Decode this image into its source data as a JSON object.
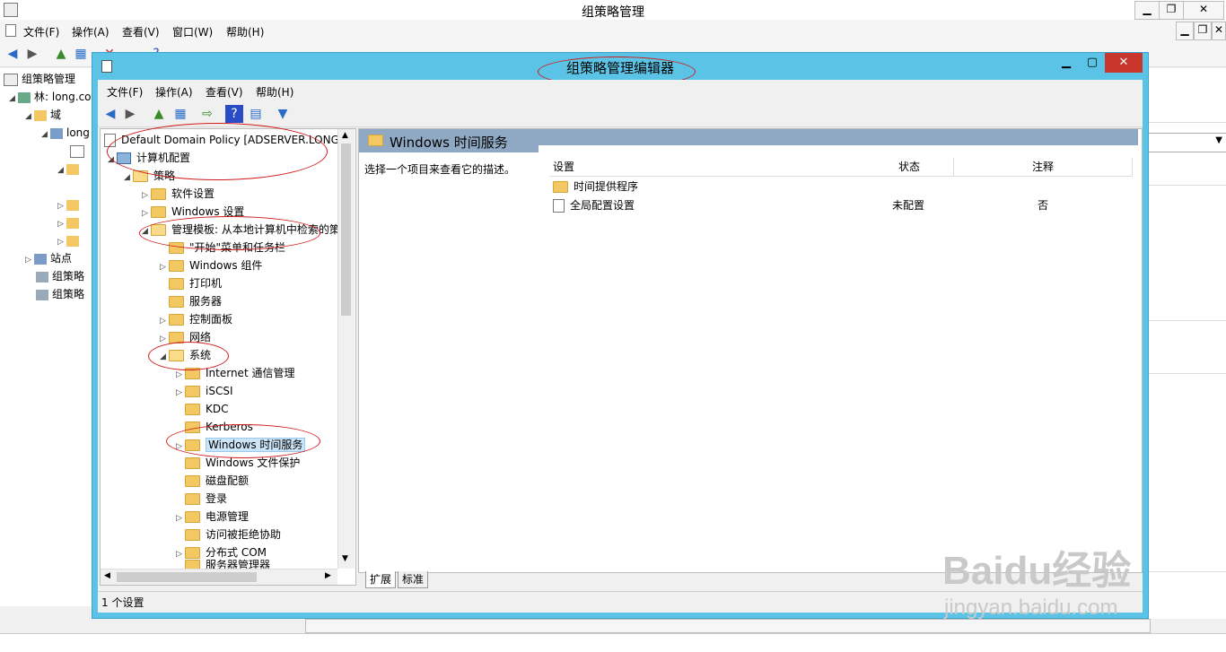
{
  "outer": {
    "title": "组策略管理",
    "menu": [
      "文件(F)",
      "操作(A)",
      "查看(V)",
      "窗口(W)",
      "帮助(H)"
    ],
    "tree": [
      {
        "label": "组策略管理"
      },
      {
        "label": "林: long.co"
      },
      {
        "label": "域"
      },
      {
        "label": "long"
      },
      {
        "label": "站点"
      },
      {
        "label": "组策略"
      },
      {
        "label": "组策略"
      }
    ]
  },
  "inner": {
    "title": "组策略管理编辑器",
    "menu": [
      "文件(F)",
      "操作(A)",
      "查看(V)",
      "帮助(H)"
    ],
    "tree": [
      {
        "label": "Default Domain Policy [ADSERVER.LONG.C"
      },
      {
        "label": "计算机配置"
      },
      {
        "label": "策略"
      },
      {
        "label": "软件设置"
      },
      {
        "label": "Windows 设置"
      },
      {
        "label": "管理模板: 从本地计算机中检索的策"
      },
      {
        "label": "\"开始\"菜单和任务栏"
      },
      {
        "label": "Windows 组件"
      },
      {
        "label": "打印机"
      },
      {
        "label": "服务器"
      },
      {
        "label": "控制面板"
      },
      {
        "label": "网络"
      },
      {
        "label": "系统"
      },
      {
        "label": "Internet 通信管理"
      },
      {
        "label": "iSCSI"
      },
      {
        "label": "KDC"
      },
      {
        "label": "Kerberos"
      },
      {
        "label": "Windows 时间服务"
      },
      {
        "label": "Windows 文件保护"
      },
      {
        "label": "磁盘配额"
      },
      {
        "label": "登录"
      },
      {
        "label": "电源管理"
      },
      {
        "label": "访问被拒绝协助"
      },
      {
        "label": "分布式 COM"
      },
      {
        "label": "服务器管理器"
      }
    ],
    "right_title": "Windows 时间服务",
    "description": "选择一个项目来查看它的描述。",
    "columns": [
      "设置",
      "状态",
      "注释"
    ],
    "rows": [
      {
        "name": "时间提供程序",
        "state": "",
        "note": ""
      },
      {
        "name": "全局配置设置",
        "state": "未配置",
        "note": "否"
      }
    ],
    "tabs": [
      "扩展",
      "标准"
    ],
    "status": "1 个设置"
  },
  "watermark": {
    "big": "Baidu经验",
    "small": "jingyan.baidu.com"
  },
  "colors": {
    "inner_frame": "#5bc4e6",
    "annotation": "#d01b1b",
    "header_band": "#8fa9c4"
  }
}
